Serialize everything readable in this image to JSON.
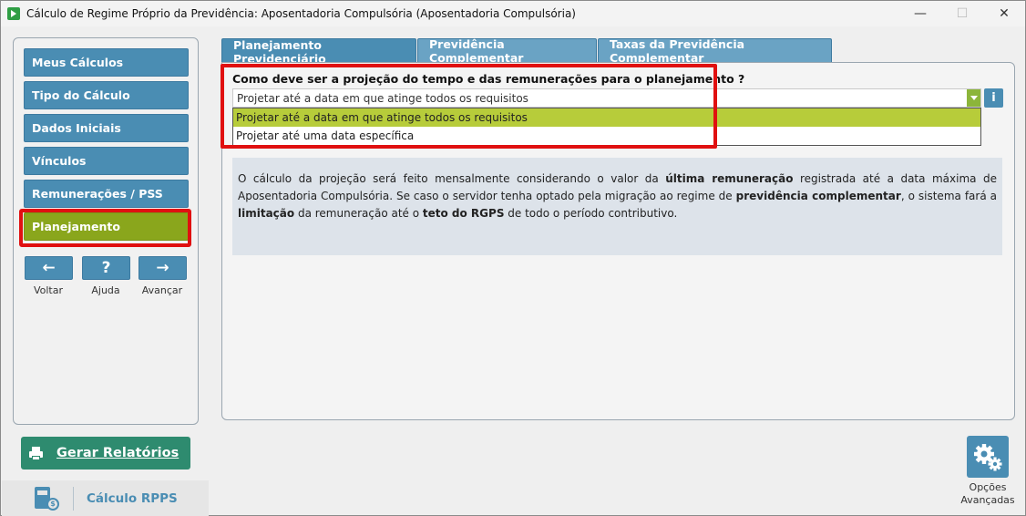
{
  "window": {
    "title": "Cálculo de Regime Próprio da Previdência: Aposentadoria Compulsória (Aposentadoria Compulsória)",
    "minimize": "—",
    "maximize": "☐",
    "close": "✕"
  },
  "sidebar": {
    "items": [
      {
        "label": "Meus Cálculos"
      },
      {
        "label": "Tipo do Cálculo"
      },
      {
        "label": "Dados Iniciais"
      },
      {
        "label": "Vínculos"
      },
      {
        "label": "Remunerações / PSS"
      },
      {
        "label": "Planejamento"
      }
    ],
    "active": "Planejamento",
    "nav": {
      "back_icon": "←",
      "back_label": "Voltar",
      "help_icon": "?",
      "help_label": "Ajuda",
      "next_icon": "→",
      "next_label": "Avançar"
    }
  },
  "report_button": {
    "label": "Gerar Relatórios",
    "icon": "printer-icon"
  },
  "brand": {
    "name": "Cálculo RPPS",
    "coin_symbol": "$"
  },
  "tabs": [
    {
      "label": "Planejamento Previdenciário",
      "active": true
    },
    {
      "label": "Previdência Complementar",
      "active": false
    },
    {
      "label": "Taxas da Previdência Complementar",
      "active": false
    }
  ],
  "planning": {
    "question": "Como deve ser a projeção do tempo e das remunerações para o planejamento ?",
    "selected_value": "Projetar até a data em que atinge todos os requisitos",
    "options": [
      "Projetar até a data em que atinge todos os requisitos",
      "Projetar até uma data específica"
    ],
    "info_icon": "i",
    "description": {
      "p1": "O cálculo da projeção será feito mensalmente considerando o valor da ",
      "b1": "última remuneração",
      "p2": " registrada até a data máxima de Aposentadoria Compulsória. Se caso o servidor tenha optado pela migração ao regime de ",
      "b2": "previdência complementar",
      "p3": ", o sistema fará a ",
      "b3": "limitação",
      "p4": " da remuneração até o ",
      "b4": "teto do RGPS",
      "p5": " de todo o período contributivo."
    }
  },
  "advanced_options": {
    "line1": "Opções",
    "line2": "Avançadas",
    "icon": "gears-icon"
  },
  "colors": {
    "nav_blue": "#4a8db3",
    "active_green": "#8aa61c",
    "report_green": "#2e8b6f",
    "highlight_red": "#e01010",
    "selected_option": "#b7cc3a"
  }
}
